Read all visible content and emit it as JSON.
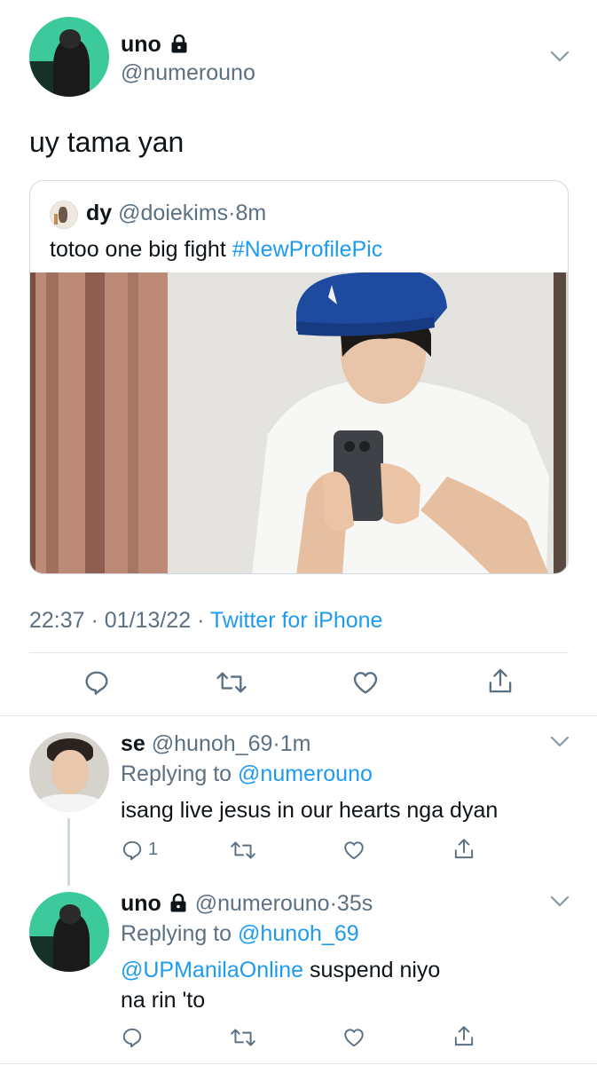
{
  "main_tweet": {
    "author_name": "uno",
    "author_handle": "@numerouno",
    "text": "uy tama yan",
    "meta_time": "22:37",
    "meta_date": "01/13/22",
    "meta_sep": "·",
    "source": "Twitter for iPhone"
  },
  "quoted_tweet": {
    "author_name": "dy",
    "author_handle": "@doiekims",
    "time": "8m",
    "text": "totoo one big fight ",
    "hashtag": "#NewProfilePic"
  },
  "replies": [
    {
      "author_name": "se",
      "author_handle": "@hunoh_69",
      "time": "1m",
      "replying_label": "Replying to ",
      "replying_to": "@numerouno",
      "text": "isang live jesus in our hearts nga dyan",
      "reply_count": "1"
    },
    {
      "author_name": "uno",
      "author_handle": "@numerouno",
      "time": "35s",
      "replying_label": "Replying to ",
      "replying_to": "@hunoh_69",
      "text_line1_mention": "@UPManilaOnline",
      "text_line1_rest": " suspend niyo",
      "text_line2": "na rin 'to"
    }
  ],
  "colors": {
    "link": "#1d9bf0",
    "secondary_text": "#5b7083",
    "primary_text": "#0f1419",
    "divider": "#e1e8ed",
    "avatar_green": "#3cc99c"
  },
  "icons": [
    "lock-icon",
    "chevron-down-icon",
    "reply-icon",
    "retweet-icon",
    "like-icon",
    "share-icon"
  ]
}
